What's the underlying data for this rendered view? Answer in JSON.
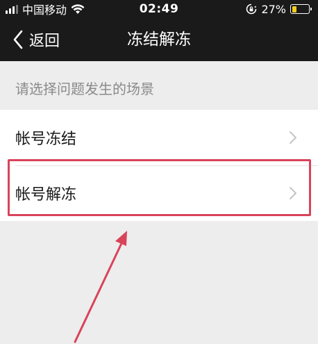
{
  "status_bar": {
    "carrier": "中国移动",
    "time": "02:49",
    "battery_percent": "27%",
    "battery_level": 0.27,
    "icons": [
      "signal-icon",
      "wifi-icon",
      "rotation-lock-icon",
      "battery-icon"
    ]
  },
  "nav": {
    "back_label": "返回",
    "title": "冻结解冻"
  },
  "section_header": "请选择问题发生的场景",
  "list": {
    "items": [
      {
        "label": "帐号冻结"
      },
      {
        "label": "帐号解冻"
      }
    ]
  },
  "annotation": {
    "color": "#d9435a"
  },
  "colors": {
    "nav_background": "#1a1a1a",
    "page_background": "#ededed",
    "battery": "#f7cc1f"
  }
}
